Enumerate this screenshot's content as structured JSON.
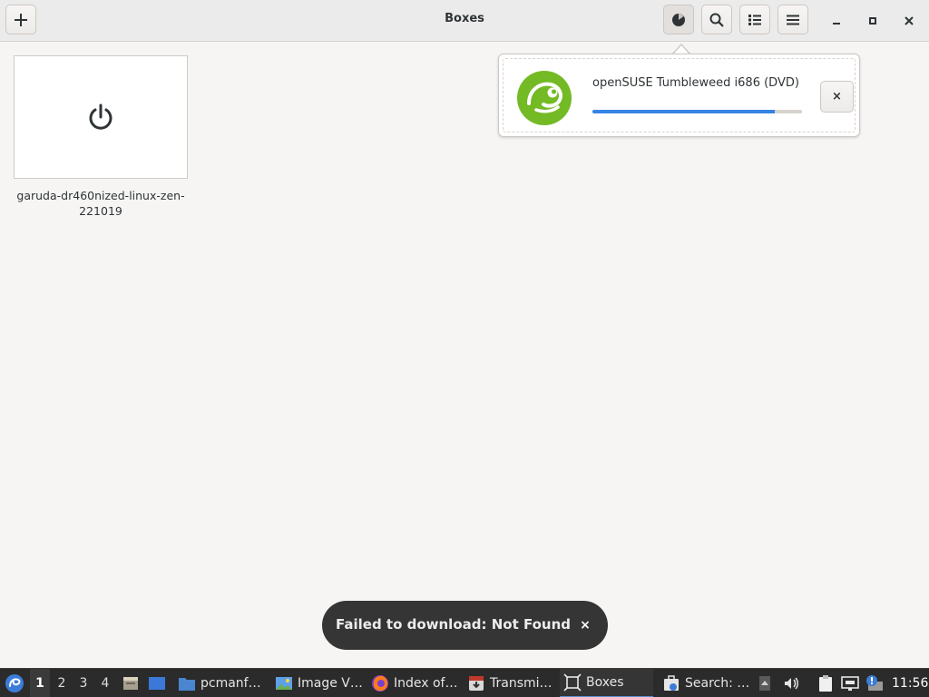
{
  "window": {
    "title": "Boxes"
  },
  "toolbar": {
    "new_icon": "plus-icon",
    "downloads_icon": "pie-progress-icon",
    "search_icon": "search-icon",
    "view_icon": "list-view-icon",
    "menu_icon": "hamburger-menu-icon",
    "minimize_icon": "minimize-icon",
    "maximize_icon": "maximize-icon",
    "close_icon": "close-icon"
  },
  "vms": [
    {
      "name": "garuda-dr460nized-linux-zen-221019",
      "icon": "power-icon"
    }
  ],
  "download": {
    "name": "openSUSE Tumbleweed i686 (DVD)",
    "progress": 0.87,
    "cancel_label": "×",
    "logo_icon": "opensuse-gecko-logo",
    "colors": {
      "logo": "#73ba25",
      "progress": "#3584e4"
    }
  },
  "toast": {
    "message": "Failed to download: Not Found",
    "close_label": "×"
  },
  "taskbar": {
    "workspaces": [
      "1",
      "2",
      "3",
      "4"
    ],
    "active_workspace": "1",
    "tasks": [
      {
        "label": "pcmanf…",
        "icon": "folder-icon"
      },
      {
        "label": "Image V…",
        "icon": "image-viewer-icon"
      },
      {
        "label": "Index of…",
        "icon": "firefox-icon"
      },
      {
        "label": "Transmi…",
        "icon": "transmission-icon"
      },
      {
        "label": "Boxes",
        "icon": "boxes-icon"
      },
      {
        "label": "Search: …",
        "icon": "search-app-icon"
      }
    ],
    "clock": "11:56"
  }
}
